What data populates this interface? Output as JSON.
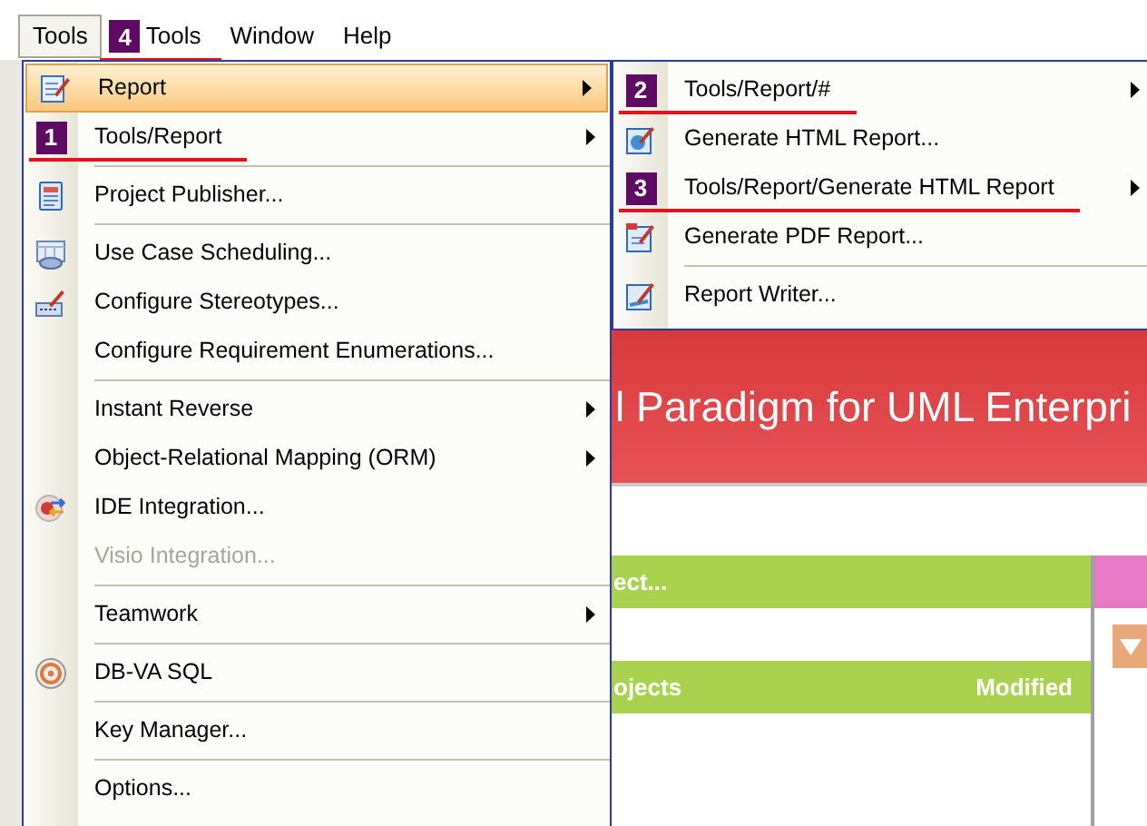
{
  "menubar": [
    {
      "label": "Tools",
      "selected": true,
      "annotated": false
    },
    {
      "label": "Tools",
      "badge": "4",
      "selected": false,
      "annotated": true
    },
    {
      "label": "Window",
      "selected": false,
      "annotated": false
    },
    {
      "label": "Help",
      "selected": false,
      "annotated": false
    }
  ],
  "menu": {
    "items": [
      {
        "label": "Report",
        "kind": "report",
        "submenu": true,
        "selected": true,
        "disabled": false,
        "annotated": false,
        "separator_above": false
      },
      {
        "label": "Tools/Report",
        "badge": "1",
        "submenu": true,
        "selected": false,
        "disabled": false,
        "annotated": true,
        "separator_above": false
      },
      {
        "label": "Project Publisher...",
        "kind": "publisher",
        "submenu": false,
        "selected": false,
        "disabled": false,
        "annotated": false,
        "separator_above": true
      },
      {
        "label": "Use Case Scheduling...",
        "kind": "scheduling",
        "submenu": false,
        "selected": false,
        "disabled": false,
        "annotated": false,
        "separator_above": true
      },
      {
        "label": "Configure Stereotypes...",
        "kind": "stereotypes",
        "submenu": false,
        "selected": false,
        "disabled": false,
        "annotated": false,
        "separator_above": false
      },
      {
        "label": "Configure Requirement Enumerations...",
        "submenu": false,
        "selected": false,
        "disabled": false,
        "annotated": false,
        "separator_above": false
      },
      {
        "label": "Instant Reverse",
        "submenu": true,
        "selected": false,
        "disabled": false,
        "annotated": false,
        "separator_above": true
      },
      {
        "label": "Object-Relational Mapping (ORM)",
        "submenu": true,
        "selected": false,
        "disabled": false,
        "annotated": false,
        "separator_above": false
      },
      {
        "label": "IDE Integration...",
        "kind": "ide",
        "submenu": false,
        "selected": false,
        "disabled": false,
        "annotated": false,
        "separator_above": false
      },
      {
        "label": "Visio Integration...",
        "submenu": false,
        "selected": false,
        "disabled": true,
        "annotated": false,
        "separator_above": false
      },
      {
        "label": "Teamwork",
        "submenu": true,
        "selected": false,
        "disabled": false,
        "annotated": false,
        "separator_above": true
      },
      {
        "label": "DB-VA SQL",
        "kind": "dbva",
        "submenu": false,
        "selected": false,
        "disabled": false,
        "annotated": false,
        "separator_above": true
      },
      {
        "label": "Key Manager...",
        "submenu": false,
        "selected": false,
        "disabled": false,
        "annotated": false,
        "separator_above": true
      },
      {
        "label": "Options...",
        "submenu": false,
        "selected": false,
        "disabled": false,
        "annotated": false,
        "separator_above": true
      }
    ]
  },
  "submenu": {
    "items": [
      {
        "label": "Tools/Report/#",
        "badge": "2",
        "submenu": true,
        "selected": false,
        "disabled": false,
        "annotated": true,
        "separator_above": false
      },
      {
        "label": "Generate HTML Report...",
        "kind": "html",
        "submenu": false,
        "selected": false,
        "disabled": false,
        "annotated": false,
        "separator_above": false
      },
      {
        "label": "Tools/Report/Generate HTML Report",
        "badge": "3",
        "submenu": true,
        "selected": false,
        "disabled": false,
        "annotated": true,
        "separator_above": false
      },
      {
        "label": "Generate PDF Report...",
        "kind": "pdf",
        "submenu": false,
        "selected": false,
        "disabled": false,
        "annotated": false,
        "separator_above": false
      },
      {
        "label": "Report Writer...",
        "kind": "writer",
        "submenu": false,
        "selected": false,
        "disabled": false,
        "annotated": false,
        "separator_above": true
      }
    ]
  },
  "banner": {
    "title": "l Paradigm for UML Enterpri"
  },
  "projects_panel": {
    "header": "ect...",
    "columns": [
      "ojects",
      "Modified"
    ]
  }
}
